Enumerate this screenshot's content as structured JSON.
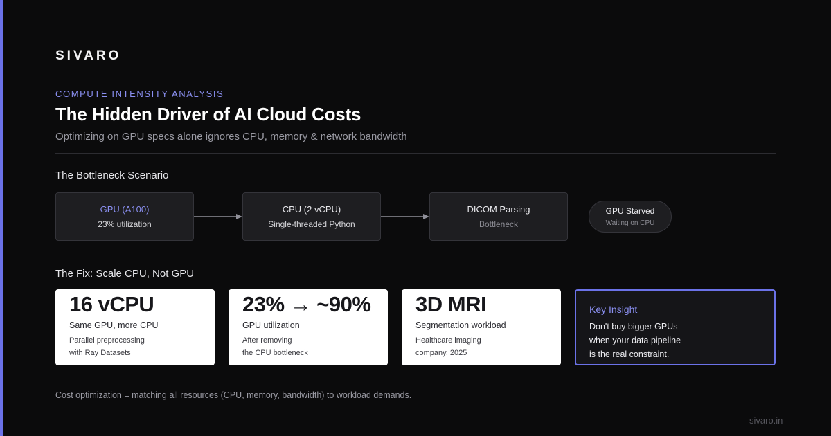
{
  "brand": {
    "logo": "SIVARO",
    "site": "sivaro.in",
    "accent_color": "#6b72e8"
  },
  "header": {
    "eyebrow": "COMPUTE INTENSITY ANALYSIS",
    "title": "The Hidden Driver of AI Cloud Costs",
    "subtitle": "Optimizing on GPU specs alone ignores CPU, memory & network bandwidth"
  },
  "bottleneck": {
    "label": "The Bottleneck Scenario",
    "steps": [
      {
        "title": "GPU (A100)",
        "subtitle": "23% utilization"
      },
      {
        "title": "CPU (2 vCPU)",
        "subtitle": "Single-threaded Python"
      },
      {
        "title": "DICOM Parsing",
        "subtitle": "Bottleneck"
      }
    ],
    "result": {
      "title": "GPU Starved",
      "subtitle": "Waiting on CPU"
    }
  },
  "fix": {
    "label": "The Fix: Scale CPU, Not GPU",
    "cards": [
      {
        "big": "16 vCPU",
        "label": "Same GPU, more CPU",
        "note": "Parallel preprocessing\nwith Ray Datasets"
      },
      {
        "big": "23% → ~90%",
        "label": "GPU utilization",
        "note": "After removing\nthe CPU bottleneck"
      },
      {
        "big": "3D MRI",
        "label": "Segmentation workload",
        "note": "Healthcare imaging\ncompany, 2025"
      }
    ],
    "insight": {
      "title": "Key Insight",
      "body": "Don't buy bigger GPUs\nwhen your data pipeline\nis the real constraint."
    }
  },
  "footer": {
    "note": "Cost optimization = matching all resources (CPU, memory, bandwidth) to workload demands."
  }
}
